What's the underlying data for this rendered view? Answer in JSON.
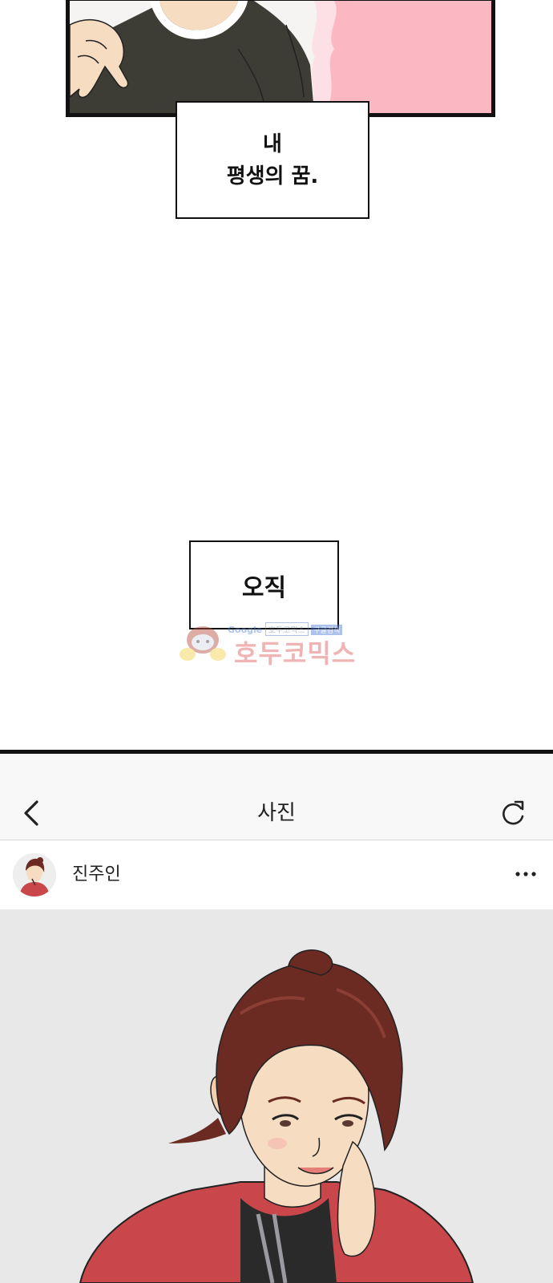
{
  "comic": {
    "caption_1_line_1": "내",
    "caption_1_line_2": "평생의 꿈.",
    "caption_2": "오직"
  },
  "watermark": {
    "search_engine": "Google",
    "search_query": "호두코믹스",
    "search_button": "구글검색",
    "brand": "호두코믹스"
  },
  "phone_ui": {
    "title": "사진",
    "back_icon": "chevron-left-icon",
    "refresh_icon": "refresh-icon",
    "post": {
      "username": "진주인",
      "more_icon": "more-horizontal-icon"
    }
  },
  "colors": {
    "panel_pink": "#fbb8c2",
    "shirt_dark": "#3d3d35",
    "skin": "#f6dcc0",
    "jacket_red": "#c9474a",
    "hair_brown": "#6b2a22",
    "photo_bg": "#e8e8e8",
    "watermark_red": "#e05a5a"
  }
}
